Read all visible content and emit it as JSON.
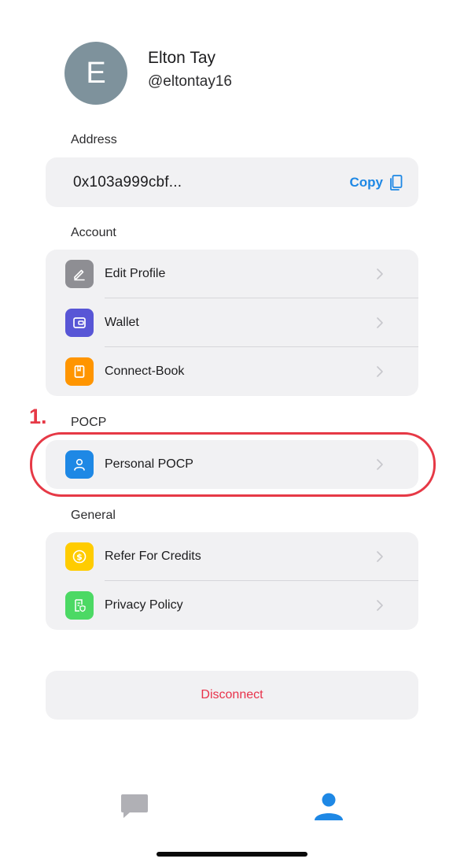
{
  "profile": {
    "avatar_initial": "E",
    "name": "Elton Tay",
    "handle": "@eltontay16"
  },
  "address": {
    "section_label": "Address",
    "value": "0x103a999cbf...",
    "copy_label": "Copy"
  },
  "account": {
    "section_label": "Account",
    "items": [
      {
        "label": "Edit Profile",
        "icon": "pencil-icon",
        "color": "#8e8e93"
      },
      {
        "label": "Wallet",
        "icon": "wallet-icon",
        "color": "#5856d6"
      },
      {
        "label": "Connect-Book",
        "icon": "book-icon",
        "color": "#ff9500"
      }
    ]
  },
  "pocp": {
    "section_label": "POCP",
    "items": [
      {
        "label": "Personal POCP",
        "icon": "person-icon",
        "color": "#1e88e5"
      }
    ]
  },
  "general": {
    "section_label": "General",
    "items": [
      {
        "label": "Refer For Credits",
        "icon": "dollar-coin-icon",
        "color": "#ffcc00"
      },
      {
        "label": "Privacy Policy",
        "icon": "document-shield-icon",
        "color": "#4cd964"
      }
    ]
  },
  "disconnect_label": "Disconnect",
  "annotation": {
    "step_number": "1.",
    "color": "#e63946"
  },
  "tab_bar": {
    "tabs": [
      {
        "icon": "chat-bubble-icon",
        "active": false
      },
      {
        "icon": "profile-icon",
        "active": true
      }
    ],
    "active_color": "#1e88e5",
    "inactive_color": "#b0b0b5"
  }
}
